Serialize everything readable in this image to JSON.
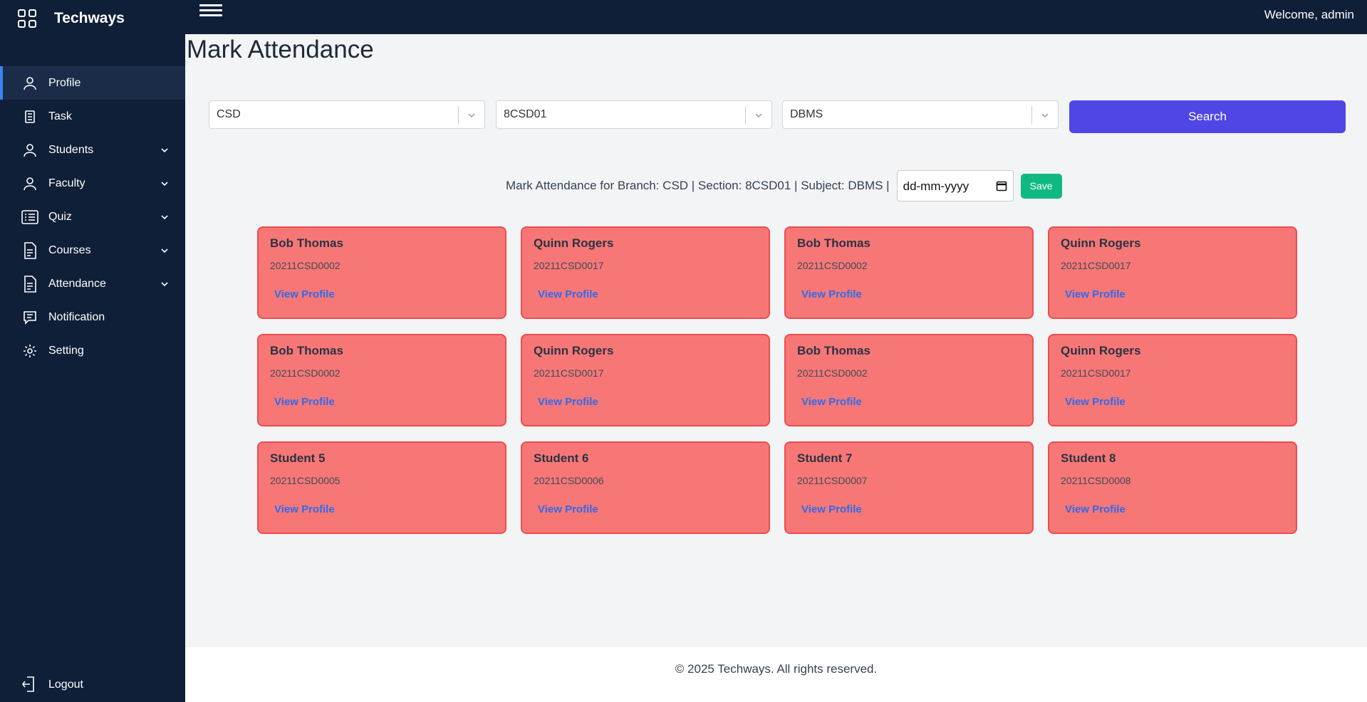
{
  "brand": {
    "name": "Techways",
    "icon": "grid-icon"
  },
  "header": {
    "welcome": "Welcome, admin",
    "menu_icon": "hamburger-icon"
  },
  "sidebar": {
    "items": [
      {
        "label": "Profile",
        "icon": "user-icon",
        "active": true,
        "expandable": false
      },
      {
        "label": "Task",
        "icon": "clipboard-icon",
        "active": false,
        "expandable": false
      },
      {
        "label": "Students",
        "icon": "user-icon",
        "active": false,
        "expandable": true
      },
      {
        "label": "Faculty",
        "icon": "user-icon",
        "active": false,
        "expandable": true
      },
      {
        "label": "Quiz",
        "icon": "list-icon",
        "active": false,
        "expandable": true
      },
      {
        "label": "Courses",
        "icon": "document-icon",
        "active": false,
        "expandable": true
      },
      {
        "label": "Attendance",
        "icon": "document-icon",
        "active": false,
        "expandable": true
      },
      {
        "label": "Notification",
        "icon": "message-icon",
        "active": false,
        "expandable": false
      },
      {
        "label": "Setting",
        "icon": "gear-icon",
        "active": false,
        "expandable": false
      }
    ],
    "logout": "Logout"
  },
  "main": {
    "title": "Mark Attendance",
    "filters": {
      "branch": "CSD",
      "section": "8CSD01",
      "subject": "DBMS",
      "search_label": "Search"
    },
    "mark_text": "Mark Attendance for Branch: CSD | Section: 8CSD01 | Subject: DBMS |",
    "date_placeholder": "dd-mm-yyyy",
    "save_label": "Save",
    "view_profile_label": "View Profile",
    "students": [
      {
        "name": "Bob Thomas",
        "roll": "20211CSD0002"
      },
      {
        "name": "Quinn Rogers",
        "roll": "20211CSD0017"
      },
      {
        "name": "Bob Thomas",
        "roll": "20211CSD0002"
      },
      {
        "name": "Quinn Rogers",
        "roll": "20211CSD0017"
      },
      {
        "name": "Bob Thomas",
        "roll": "20211CSD0002"
      },
      {
        "name": "Quinn Rogers",
        "roll": "20211CSD0017"
      },
      {
        "name": "Bob Thomas",
        "roll": "20211CSD0002"
      },
      {
        "name": "Quinn Rogers",
        "roll": "20211CSD0017"
      },
      {
        "name": "Student 5",
        "roll": "20211CSD0005"
      },
      {
        "name": "Student 6",
        "roll": "20211CSD0006"
      },
      {
        "name": "Student 7",
        "roll": "20211CSD0007"
      },
      {
        "name": "Student 8",
        "roll": "20211CSD0008"
      }
    ]
  },
  "footer": {
    "text": "© 2025 Techways. All rights reserved."
  },
  "colors": {
    "sidebar_bg": "#0f1f38",
    "accent": "#4f46e5",
    "save": "#10b981",
    "absent_card": "#f87171",
    "link": "#2563eb"
  }
}
